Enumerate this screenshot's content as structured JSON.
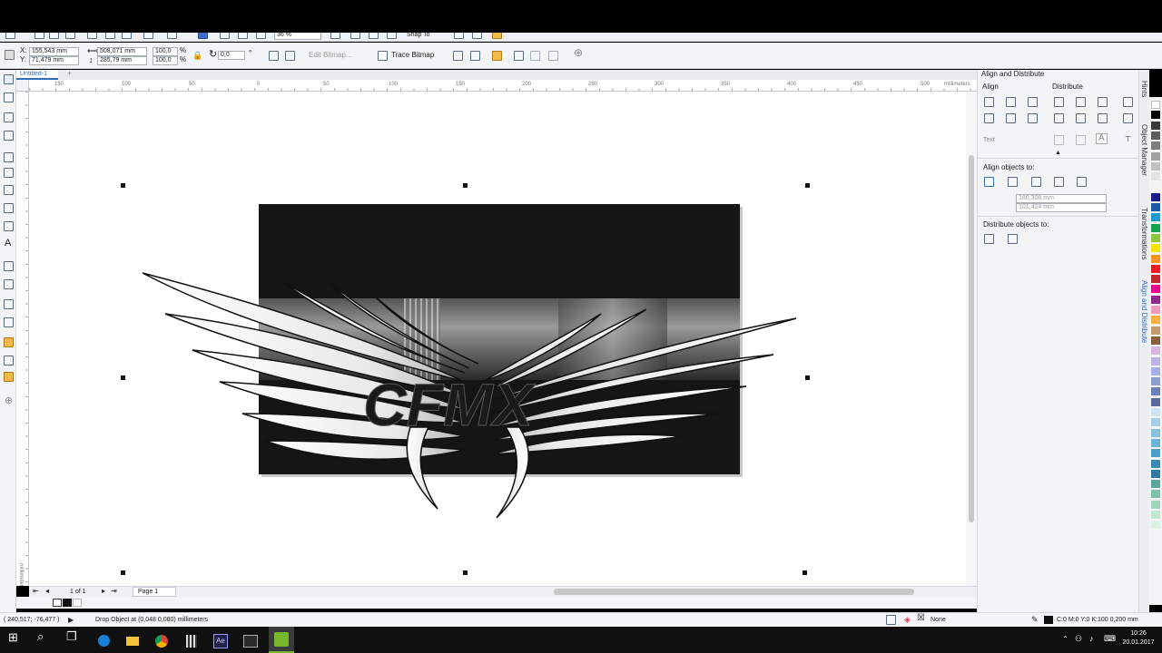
{
  "property_bar": {
    "x_label": "X:",
    "x_value": "155,543 mm",
    "y_label": "Y:",
    "y_value": "71,479 mm",
    "w_value": "508,071 mm",
    "h_value": "285,79 mm",
    "scale_x": "100,0",
    "scale_y": "100,0",
    "percent": "%",
    "rotation": "0,0",
    "degree": "°",
    "edit_bitmap_label": "Edit Bitmap...",
    "trace_bitmap_label": "Trace Bitmap"
  },
  "standard_bar": {
    "zoom": "36 %",
    "snap_label": "Snap To"
  },
  "document_tab": {
    "title": "Untitled-1",
    "add": "+"
  },
  "ruler": {
    "ticks": [
      "150",
      "100",
      "50",
      "0",
      "50",
      "100",
      "150",
      "200",
      "250",
      "300",
      "350",
      "400",
      "450",
      "500"
    ],
    "unit": "millimeters",
    "vertical_unit": "millimeters"
  },
  "artwork": {
    "logo_text": "CFMX"
  },
  "page_nav": {
    "count": "1 of 1",
    "page_tab": "Page 1"
  },
  "docker": {
    "title": "Align and Distribute",
    "align_heading": "Align",
    "distribute_heading": "Distribute",
    "text_label": "Text",
    "align_objects_to": "Align objects to:",
    "x_value": "180,308 mm",
    "y_value": "101,424 mm",
    "distribute_objects_to": "Distribute objects to:"
  },
  "side_tabs": [
    "Hints",
    "Object Manager",
    "Transformations",
    "Align and Distribute"
  ],
  "status_bar": {
    "coordinates": "( 240,517; -76,477 )",
    "message": "Drop Object at (0,048 0,080) millimeters",
    "fill_label": "None",
    "outline_label": "C:0 M:0 Y:0 K:100  0,200 mm"
  },
  "taskbar": {
    "time": "10:26",
    "date": "20.01.2017"
  },
  "palette_colors": [
    "#ffffff",
    "#000000",
    "#3a3a3a",
    "#5c5c5c",
    "#7e7e7e",
    "#a0a0a0",
    "#c2c2c2",
    "#e4e4e4",
    "#f4f4f4",
    "#1c1c8c",
    "#1d5aa8",
    "#1b9bd6",
    "#16a34a",
    "#8cc63f",
    "#f5e400",
    "#f7941d",
    "#ed1c24",
    "#c1272d",
    "#ec008c",
    "#92278f",
    "#f49ac1",
    "#fbb040",
    "#c69c6d",
    "#8b5e3c",
    "#d8b6e0",
    "#bdb3e8",
    "#a6aee8",
    "#8d9ed0",
    "#6f7fb8",
    "#5a6aa0",
    "#cfe3f3",
    "#a6cde8",
    "#86c1e0",
    "#6bb4d9",
    "#4c9dc9",
    "#3a8ab8",
    "#2f7aa4",
    "#5aa89a",
    "#7cc2a8",
    "#9fd6bb",
    "#c1e8cf",
    "#dff3e4"
  ],
  "colors": {
    "accent": "#2f6fba",
    "taskbar_active": "#76b82a"
  }
}
